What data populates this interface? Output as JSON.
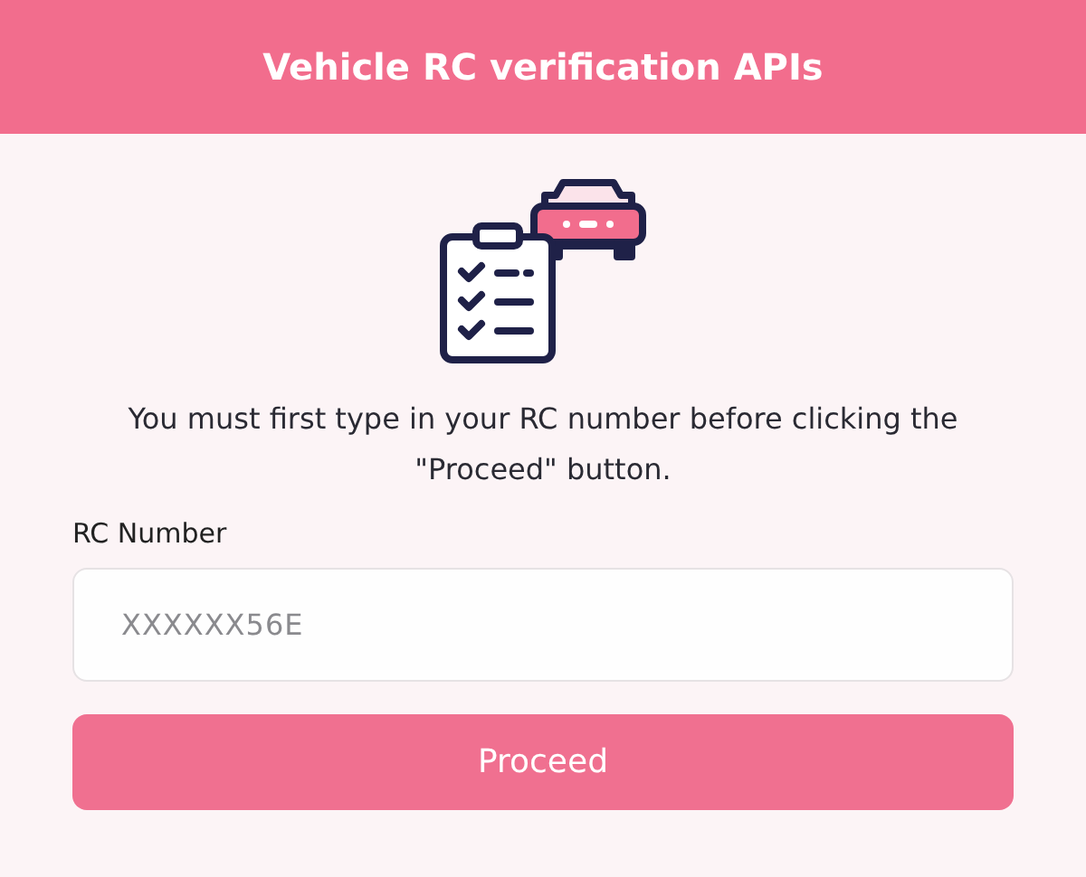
{
  "header": {
    "title": "Vehicle RC verification APIs"
  },
  "instructions": "You must first type in your RC number before clicking the \"Proceed\" button.",
  "field": {
    "label": "RC Number",
    "placeholder": "XXXXXX56E"
  },
  "button": {
    "label": "Proceed"
  }
}
